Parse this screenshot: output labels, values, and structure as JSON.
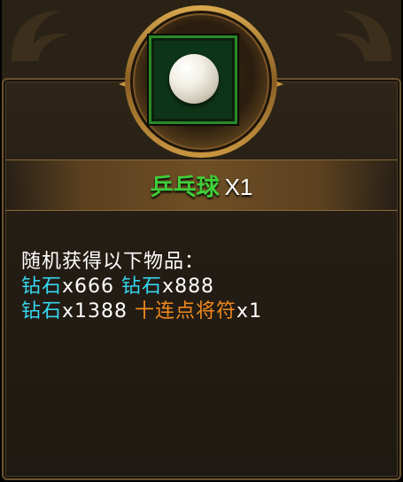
{
  "item": {
    "name": "乒乓球",
    "quantity": "X1",
    "icon": "ping-pong-ball-icon"
  },
  "description": {
    "heading": "随机获得以下物品：",
    "rewards_line1": [
      {
        "name": "钻石",
        "amount": "x666",
        "color": "#36d6f0"
      },
      {
        "name": "钻石",
        "amount": "x888",
        "color": "#36d6f0"
      }
    ],
    "rewards_line2": [
      {
        "name": "钻石",
        "amount": "x1388",
        "color": "#36d6f0"
      },
      {
        "name": "十连点将符",
        "amount": "x1",
        "color": "#f08a1e"
      }
    ]
  },
  "colors": {
    "item_name": "#3fcf3a",
    "item_frame": "#2a8a2a",
    "panel_border": "#6b5330"
  }
}
